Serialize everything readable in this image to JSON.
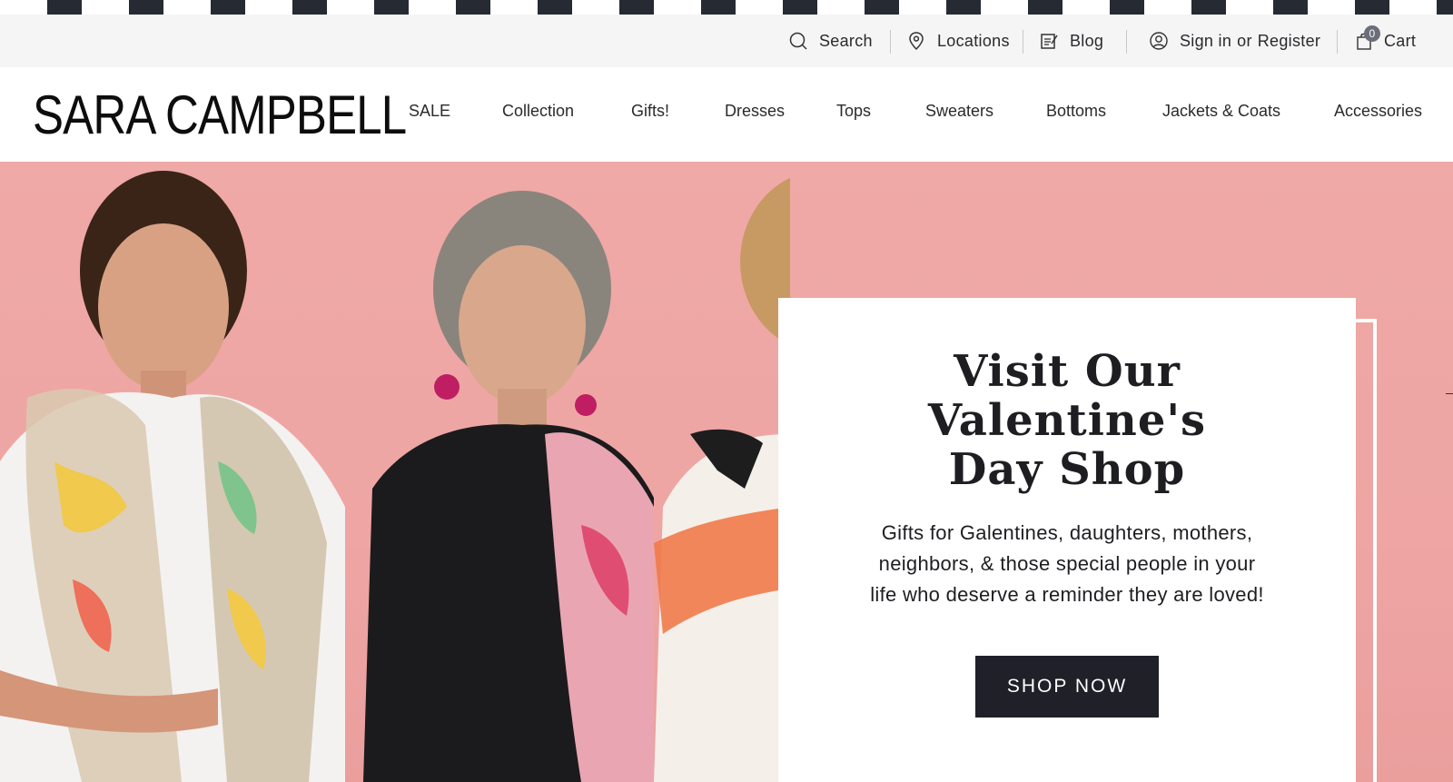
{
  "utility_bar": {
    "search_label": "Search",
    "locations_label": "Locations",
    "blog_label": "Blog",
    "signin_label": "Sign in",
    "or_label": "or",
    "register_label": "Register",
    "cart_label": "Cart",
    "cart_count": "0",
    "icons": [
      "search-icon",
      "location-pin-icon",
      "blog-icon",
      "user-icon",
      "shopping-bag-icon"
    ]
  },
  "header": {
    "logo_text": "SARA CAMPBELL",
    "nav": [
      {
        "label": "SALE"
      },
      {
        "label": "Collection"
      },
      {
        "label": "Gifts!"
      },
      {
        "label": "Dresses"
      },
      {
        "label": "Tops"
      },
      {
        "label": "Sweaters"
      },
      {
        "label": "Bottoms"
      },
      {
        "label": "Jackets & Coats"
      },
      {
        "label": "Accessories"
      }
    ]
  },
  "hero": {
    "title": "Visit Our Valentine's Day Shop",
    "text": "Gifts for Galentines, daughters, mothers, neighbors, & those special people in your life who deserve a reminder they are loved!",
    "button_label": "SHOP NOW"
  },
  "colors": {
    "hero_background": "#eea5a3",
    "button_background": "#1f2028",
    "utility_background": "#f5f5f5",
    "strip_dark": "#262a33"
  }
}
